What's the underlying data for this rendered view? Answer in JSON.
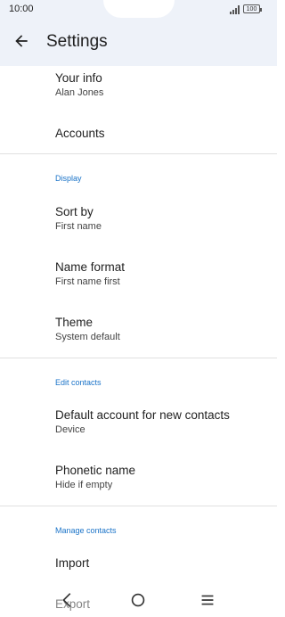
{
  "status_bar": {
    "time": "10:00",
    "battery": "100"
  },
  "app_bar": {
    "title": "Settings"
  },
  "items": {
    "your_info": {
      "title": "Your info",
      "subtitle": "Alan Jones"
    },
    "accounts": {
      "title": "Accounts"
    },
    "sort_by": {
      "title": "Sort by",
      "subtitle": "First name"
    },
    "name_format": {
      "title": "Name format",
      "subtitle": "First name first"
    },
    "theme": {
      "title": "Theme",
      "subtitle": "System default"
    },
    "default_account": {
      "title": "Default account for new contacts",
      "subtitle": "Device"
    },
    "phonetic_name": {
      "title": "Phonetic name",
      "subtitle": "Hide if empty"
    },
    "import": {
      "title": "Import"
    },
    "export": {
      "title": "Export"
    }
  },
  "sections": {
    "display": "Display",
    "edit_contacts": "Edit contacts",
    "manage_contacts": "Manage contacts"
  },
  "colors": {
    "accent": "#1a73c8",
    "appbar_bg": "#eef2f9"
  },
  "nav": {
    "back_icon": "chevron-left-icon",
    "home_icon": "circle-icon",
    "recents_icon": "menu-icon"
  }
}
